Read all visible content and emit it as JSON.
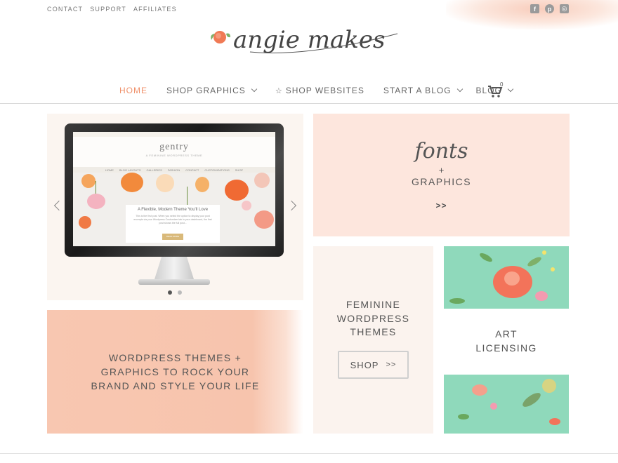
{
  "top_links": [
    "CONTACT",
    "SUPPORT",
    "AFFILIATES"
  ],
  "social": [
    {
      "icon": "facebook-icon",
      "glyph": "f"
    },
    {
      "icon": "pinterest-icon",
      "glyph": "p"
    },
    {
      "icon": "instagram-icon",
      "glyph": "◎"
    }
  ],
  "logo": {
    "text": "angie makes"
  },
  "nav": {
    "items": [
      {
        "label": "HOME",
        "active": true,
        "dropdown": false
      },
      {
        "label": "SHOP GRAPHICS",
        "active": false,
        "dropdown": true
      },
      {
        "label": "SHOP WEBSITES",
        "active": false,
        "dropdown": false,
        "star": "☆"
      },
      {
        "label": "START A BLOG",
        "active": false,
        "dropdown": true
      },
      {
        "label": "BLOG",
        "active": false,
        "dropdown": true
      }
    ],
    "cart_count": "0"
  },
  "slider": {
    "screen": {
      "brand": "gentry",
      "tagline": "A FEMININE WORDPRESS THEME",
      "nav": [
        "HOME",
        "BLOG LAYOUTS",
        "GALLERIES",
        "FASHION",
        "CONTACT",
        "CUSTOMIZATIONS",
        "SHOP"
      ],
      "card_title": "A Flexible, Modern Theme You'll Love",
      "card_text": "This is the first post. When you select the option to display your post excerpts via your Wordpress Customizer tab in your dashboard, the first post shows the full post...",
      "card_button": "READ MORE"
    },
    "active_slide": 1,
    "slide_count": 2
  },
  "fonts_tile": {
    "script": "fonts",
    "plus": "+",
    "title": "GRAPHICS",
    "more": ">>"
  },
  "blurb": {
    "lines": [
      "WORDPRESS THEMES +",
      "GRAPHICS TO ROCK YOUR",
      "BRAND AND STYLE YOUR LIFE"
    ]
  },
  "feminine_tile": {
    "lines": [
      "FEMININE",
      "WORDPRESS",
      "THEMES"
    ],
    "button": "SHOP",
    "button_arrow": ">>"
  },
  "art_tile": {
    "lines": [
      "ART",
      "LICENSING"
    ]
  },
  "colors": {
    "accent": "#f0916b",
    "peach": "#fde6dd",
    "mint": "#8fd9bb",
    "cream": "#fbf3ee"
  }
}
